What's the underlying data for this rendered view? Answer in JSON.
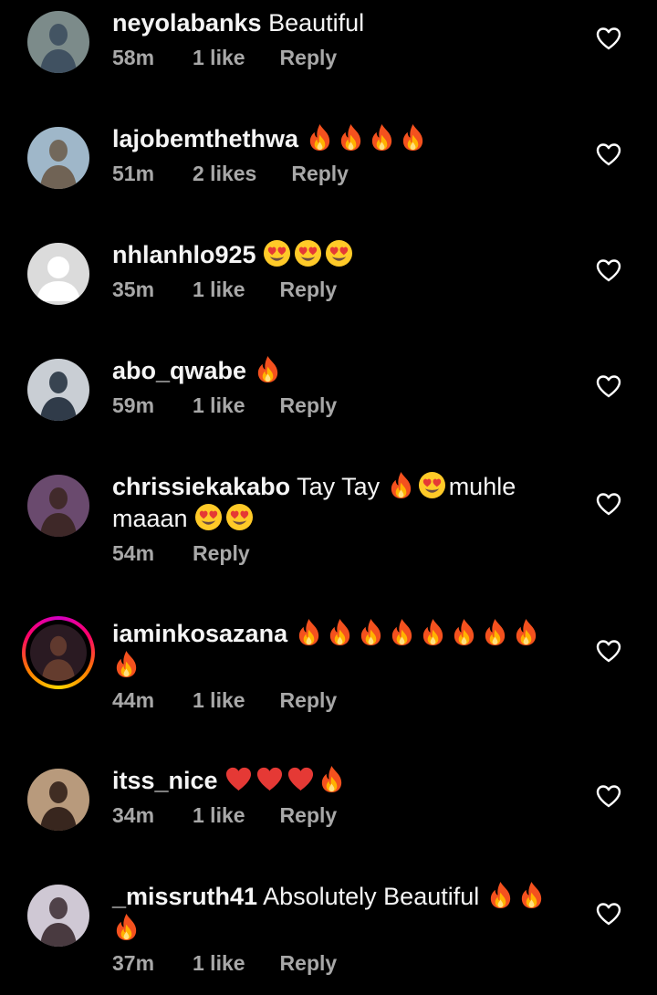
{
  "comments": [
    {
      "username": "neyolabanks",
      "text": " Beautiful",
      "emojis_after": [],
      "continuation": "",
      "continuation_emojis": [],
      "time": "58m",
      "likes": "1 like",
      "reply": "Reply",
      "avatar": {
        "kind": "photo",
        "bg": "#7c8b8a",
        "fg": "#3a4a5c",
        "story": false
      }
    },
    {
      "username": "lajobemthethwa",
      "text": " ",
      "emojis_after": [
        "fire",
        "fire",
        "fire",
        "fire"
      ],
      "continuation": "",
      "continuation_emojis": [],
      "time": "51m",
      "likes": "2 likes",
      "reply": "Reply",
      "avatar": {
        "kind": "photo",
        "bg": "#9fb7c9",
        "fg": "#6a5a48",
        "story": false
      }
    },
    {
      "username": "nhlanhlo925",
      "text": " ",
      "emojis_after": [
        "heart-eyes",
        "heart-eyes",
        "heart-eyes"
      ],
      "continuation": "",
      "continuation_emojis": [],
      "time": "35m",
      "likes": "1 like",
      "reply": "Reply",
      "avatar": {
        "kind": "default",
        "bg": "#dbdbdb",
        "fg": "#ffffff",
        "story": false
      }
    },
    {
      "username": "abo_qwabe",
      "text": " ",
      "emojis_after": [
        "fire"
      ],
      "continuation": "",
      "continuation_emojis": [],
      "time": "59m",
      "likes": "1 like",
      "reply": "Reply",
      "avatar": {
        "kind": "photo",
        "bg": "#c9ced4",
        "fg": "#1f2b3a",
        "story": false
      }
    },
    {
      "username": "chrissiekakabo",
      "text": " Tay Tay ",
      "emojis_after": [
        "fire",
        "heart-eyes"
      ],
      "text_after_emojis": "muhle maaan ",
      "continuation": "",
      "continuation_emojis": [
        "heart-eyes",
        "heart-eyes"
      ],
      "time": "54m",
      "likes": "",
      "reply": "Reply",
      "avatar": {
        "kind": "photo",
        "bg": "#6a4a6e",
        "fg": "#3a2520",
        "story": false
      }
    },
    {
      "username": "iaminkosazana",
      "text": " ",
      "emojis_after": [
        "fire",
        "fire",
        "fire",
        "fire",
        "fire",
        "fire",
        "fire",
        "fire",
        "fire"
      ],
      "continuation": "",
      "continuation_emojis": [],
      "time": "44m",
      "likes": "1 like",
      "reply": "Reply",
      "avatar": {
        "kind": "photo",
        "bg": "#2a1a22",
        "fg": "#6a4030",
        "story": true
      }
    },
    {
      "username": "itss_nice",
      "text": " ",
      "emojis_after": [
        "red-heart",
        "red-heart",
        "red-heart",
        "fire"
      ],
      "continuation": "",
      "continuation_emojis": [],
      "time": "34m",
      "likes": "1 like",
      "reply": "Reply",
      "avatar": {
        "kind": "photo",
        "bg": "#b89a7c",
        "fg": "#2a1a14",
        "story": false
      }
    },
    {
      "username": "_missruth41",
      "text": " Absolutely Beautiful ",
      "emojis_after": [
        "fire",
        "fire",
        "fire"
      ],
      "continuation": "",
      "continuation_emojis": [],
      "time": "37m",
      "likes": "1 like",
      "reply": "Reply",
      "avatar": {
        "kind": "photo",
        "bg": "#cfc8d4",
        "fg": "#3a2a30",
        "story": false
      }
    }
  ],
  "icons": {
    "like": "heart-outline-icon",
    "emoji_fire": "fire-emoji",
    "emoji_heart_eyes": "heart-eyes-emoji",
    "emoji_red_heart": "red-heart-emoji"
  },
  "colors": {
    "background": "#000000",
    "text": "#f5f5f5",
    "meta": "#a8a8a8"
  }
}
